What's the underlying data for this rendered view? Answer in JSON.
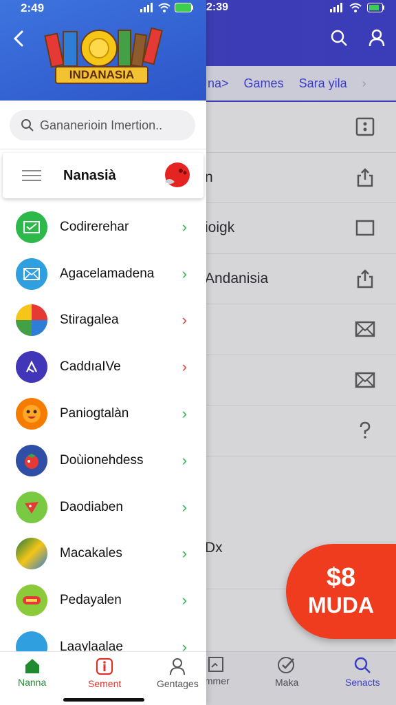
{
  "status_bar": {
    "time": "2:49",
    "time_right": "2:39"
  },
  "drawer": {
    "logo_text": "INDANASIA",
    "search": {
      "placeholder": "Gananerioin Imertion.."
    },
    "selected": {
      "title": "Nanasià"
    },
    "items": [
      {
        "label": "Codirerehar",
        "icon": "mail-square-icon",
        "color": "#2db84a",
        "arrow_color": "#2db84a"
      },
      {
        "label": "Agacelamadena",
        "icon": "envelope-icon",
        "color": "#2f9fe0",
        "arrow_color": "#2db84a"
      },
      {
        "label": "Stiragalea",
        "icon": "game-thumb-icon",
        "color": "#e53935",
        "arrow_color": "#e0443a"
      },
      {
        "label": "CaddıaIVe",
        "icon": "caret-icon",
        "color": "#4236b8",
        "arrow_color": "#e0443a"
      },
      {
        "label": "Paniogtalàn",
        "icon": "smiley-icon",
        "color": "#f57c00",
        "arrow_color": "#2db84a"
      },
      {
        "label": "Doùionehdess",
        "icon": "tomato-icon",
        "color": "#2f4ea6",
        "arrow_color": "#2db84a"
      },
      {
        "label": "Daodiaben",
        "icon": "red-shape-icon",
        "color": "#7ac943",
        "arrow_color": "#2db84a"
      },
      {
        "label": "Macakales",
        "icon": "game-thumb-icon",
        "color": "#1b7a3a",
        "arrow_color": "#2db84a"
      },
      {
        "label": "Pedayalen",
        "icon": "badge-icon",
        "color": "#8bcb3a",
        "arrow_color": "#2db84a"
      },
      {
        "label": "Laaylaalae",
        "icon": "partial-icon",
        "color": "#2f9fe0",
        "arrow_color": "#2db84a"
      }
    ],
    "bottom_nav": [
      {
        "label": "Nanna",
        "color": "#1f8a2e"
      },
      {
        "label": "Sement",
        "color": "#d9342b"
      },
      {
        "label": "Gentages",
        "color": "#555555"
      }
    ]
  },
  "background": {
    "tabs": [
      "na>",
      "Games",
      "Sara yila"
    ],
    "rows": [
      {
        "text": "",
        "icon": "dice-icon"
      },
      {
        "text": "n",
        "icon": "share-icon"
      },
      {
        "text": "ioigk",
        "icon": "square-icon"
      },
      {
        "text": "Andanisia",
        "icon": "share-icon"
      },
      {
        "text": "",
        "icon": "mail-icon"
      },
      {
        "text": "",
        "icon": "mail-icon"
      },
      {
        "text": "",
        "icon": "help-icon"
      },
      {
        "text": "",
        "icon": ""
      },
      {
        "text": "Dx",
        "icon": ""
      }
    ],
    "fab": {
      "amount": "$8",
      "label": "MUDA"
    },
    "bottom_nav": [
      {
        "label": "ımmer"
      },
      {
        "label": "Maka"
      },
      {
        "label": "Senacts"
      }
    ]
  },
  "colors": {
    "header_blue": "#3b3cb8",
    "drawer_blue": "#2c55c9",
    "accent_green": "#2db84a",
    "fab_red": "#ef3b1e"
  }
}
